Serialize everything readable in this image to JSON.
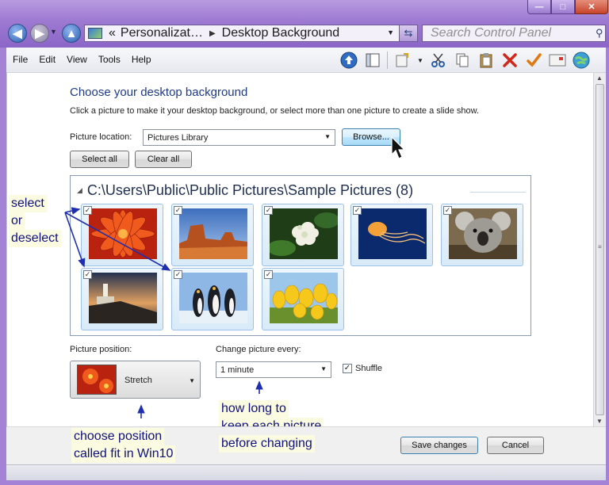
{
  "window": {
    "minimize_glyph": "—",
    "maximize_glyph": "□",
    "close_glyph": "✕"
  },
  "nav": {
    "back_icon": "arrow-left-icon",
    "forward_icon": "arrow-right-icon",
    "up_icon": "arrow-up-icon"
  },
  "address": {
    "prefix": "«",
    "crumb1": "Personalizat…",
    "crumb2": "Desktop Background"
  },
  "search": {
    "placeholder": "Search Control Panel"
  },
  "menu": [
    "File",
    "Edit",
    "View",
    "Tools",
    "Help"
  ],
  "toolbar_icons": [
    "up-circle-icon",
    "panel-icon",
    "properties-icon",
    "scissors-icon",
    "copy-icon",
    "paste-icon",
    "delete-icon",
    "check-icon",
    "mail-icon",
    "globe-icon"
  ],
  "main": {
    "title": "Choose your desktop background",
    "subtitle": "Click a picture to make it your desktop background, or select more than one picture to create a slide show.",
    "location_label": "Picture location:",
    "location_value": "Pictures Library",
    "browse_label": "Browse...",
    "select_all_label": "Select all",
    "clear_all_label": "Clear all"
  },
  "gallery": {
    "folder": "C:\\Users\\Public\\Public Pictures\\Sample Pictures (8)",
    "pictures": [
      {
        "name": "Chrysanthemum",
        "checked": true
      },
      {
        "name": "Desert",
        "checked": true
      },
      {
        "name": "Hydrangeas",
        "checked": true
      },
      {
        "name": "Jellyfish",
        "checked": true
      },
      {
        "name": "Koala",
        "checked": true
      },
      {
        "name": "Lighthouse",
        "checked": true
      },
      {
        "name": "Penguins",
        "checked": true
      },
      {
        "name": "Tulips",
        "checked": true
      }
    ]
  },
  "position": {
    "label": "Picture position:",
    "value": "Stretch"
  },
  "interval": {
    "label": "Change picture every:",
    "value": "1 minute",
    "shuffle_label": "Shuffle",
    "shuffle_checked": true
  },
  "footer": {
    "save_label": "Save changes",
    "cancel_label": "Cancel"
  },
  "annotations": {
    "select_line1": "select",
    "select_line2": "or",
    "select_line3": "deselect",
    "interval_line1": "how long to",
    "interval_line2": "keep each picture",
    "interval_line3": "before changing",
    "position_line1": "choose position",
    "position_line2": "called fit in Win10"
  }
}
